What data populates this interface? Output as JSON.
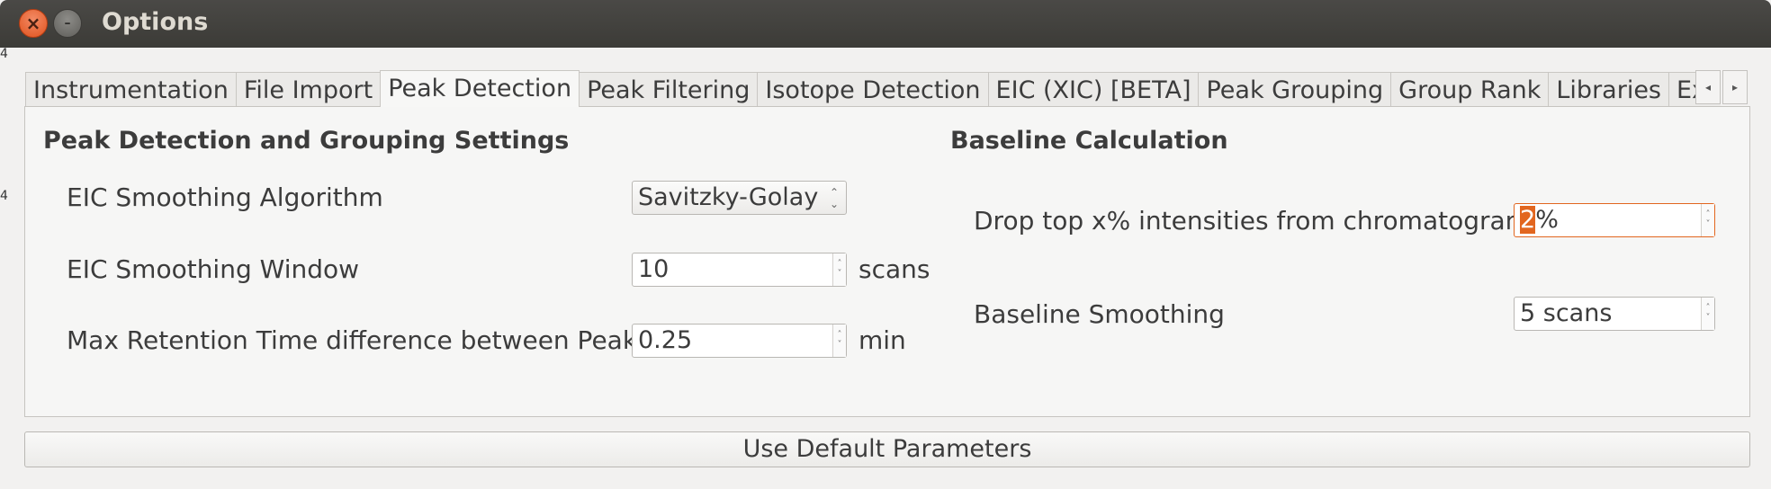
{
  "window": {
    "title": "Options"
  },
  "tabs": [
    {
      "label": "Instrumentation",
      "active": false
    },
    {
      "label": "File Import",
      "active": false
    },
    {
      "label": "Peak Detection",
      "active": true
    },
    {
      "label": "Peak Filtering",
      "active": false
    },
    {
      "label": "Isotope Detection",
      "active": false
    },
    {
      "label": "EIC (XIC) [BETA]",
      "active": false
    },
    {
      "label": "Peak Grouping",
      "active": false
    },
    {
      "label": "Group Rank",
      "active": false
    },
    {
      "label": "Libraries",
      "active": false
    },
    {
      "label": "Exter",
      "active": false
    }
  ],
  "tab_scroll": {
    "left_icon": "chevron-left-icon",
    "right_icon": "chevron-right-icon"
  },
  "peak_detection": {
    "heading": "Peak Detection and Grouping Settings",
    "smoothing_algorithm": {
      "label": "EIC Smoothing Algorithm",
      "value": "Savitzky-Golay"
    },
    "smoothing_window": {
      "label": "EIC Smoothing Window",
      "value": "10",
      "unit": "scans"
    },
    "max_rt_diff": {
      "label": "Max Retention Time difference between Peaks",
      "value": "0.25",
      "unit": "min"
    }
  },
  "baseline": {
    "heading": "Baseline Calculation",
    "drop_top": {
      "label": "Drop top x%  intensities from chromatogram",
      "value_selected": "2",
      "value_rest": "%"
    },
    "smoothing": {
      "label": "Baseline Smoothing",
      "value": "5 scans"
    }
  },
  "buttons": {
    "use_default": "Use Default Parameters"
  },
  "colors": {
    "focus": "#e2661f",
    "titlebar": "#3c3b37",
    "close": "#e0531f"
  }
}
